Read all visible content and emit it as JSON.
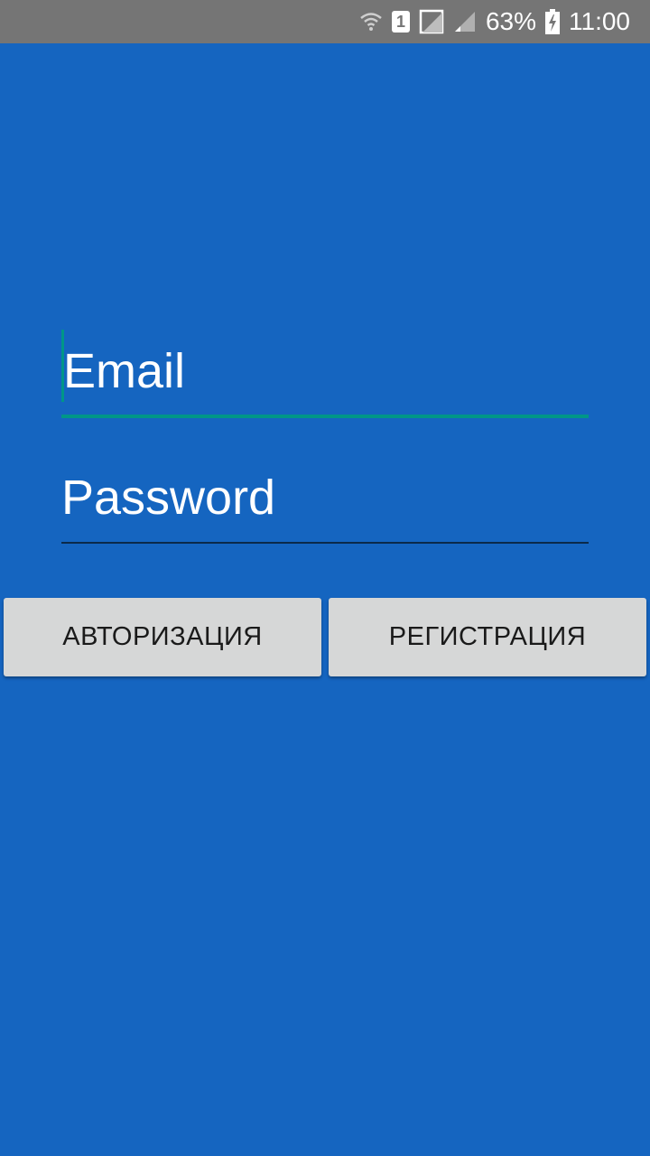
{
  "status_bar": {
    "battery_percent": "63%",
    "time": "11:00",
    "sim_slot": "1",
    "icons": [
      "wifi-icon",
      "sim-1-icon",
      "no-sim-icon",
      "signal-icon",
      "battery-charging-icon"
    ]
  },
  "login_form": {
    "email_placeholder": "Email",
    "password_placeholder": "Password",
    "login_button": "АВТОРИЗАЦИЯ",
    "register_button": "РЕГИСТРАЦИЯ"
  },
  "colors": {
    "background": "#1565C0",
    "status_bar": "#757575",
    "accent": "#009688",
    "button": "#D6D7D7"
  }
}
